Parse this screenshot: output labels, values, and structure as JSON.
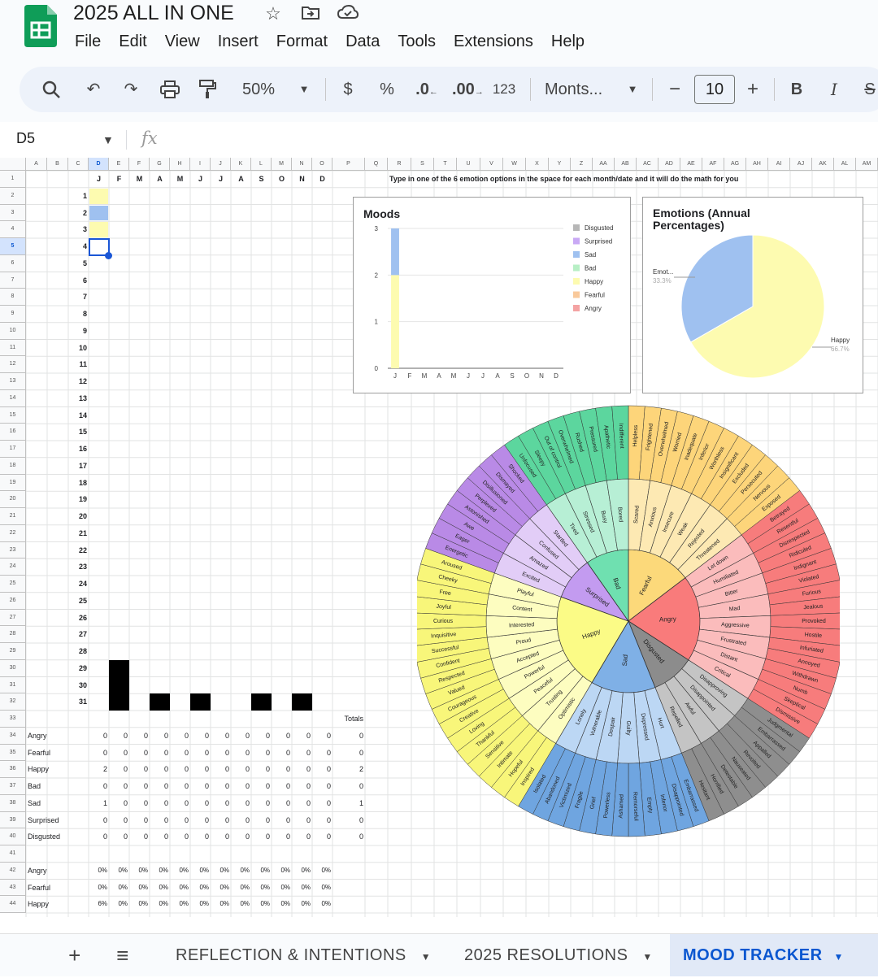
{
  "app": {
    "doc_title": "2025 ALL IN ONE",
    "menu": [
      "File",
      "Edit",
      "View",
      "Insert",
      "Format",
      "Data",
      "Tools",
      "Extensions",
      "Help"
    ],
    "icons": [
      "star-icon",
      "move-to-folder-icon",
      "cloud-status-icon"
    ]
  },
  "toolbar": {
    "zoom": "50%",
    "currency": "$",
    "percent": "%",
    "decrease_decimal": ".0",
    "increase_decimal": ".00",
    "number_format": "123",
    "font_name": "Monts...",
    "font_size": "10",
    "minus": "−",
    "plus": "+",
    "bold": "B",
    "italic": "I"
  },
  "formula_bar": {
    "cell_ref": "D5",
    "fx": "fx"
  },
  "sheet": {
    "columns": [
      "A",
      "B",
      "C",
      "D",
      "E",
      "F",
      "G",
      "H",
      "I",
      "J",
      "K",
      "L",
      "M",
      "N",
      "O",
      "P",
      "Q",
      "R",
      "S",
      "T",
      "U",
      "V",
      "W",
      "X",
      "Y",
      "Z",
      "AA",
      "AB",
      "AC",
      "AD",
      "AE",
      "AF",
      "AG",
      "AH",
      "AI",
      "AJ",
      "AK",
      "AL",
      "AM"
    ],
    "months": [
      "J",
      "F",
      "M",
      "A",
      "M",
      "J",
      "J",
      "A",
      "S",
      "O",
      "N",
      "D"
    ],
    "instruction": "Type in one of the 6 emotion options in the space for each month/date and it will do the math for you",
    "days": [
      "1",
      "2",
      "3",
      "4",
      "5",
      "6",
      "7",
      "8",
      "9",
      "10",
      "11",
      "12",
      "13",
      "14",
      "15",
      "16",
      "17",
      "18",
      "19",
      "20",
      "21",
      "22",
      "23",
      "24",
      "25",
      "26",
      "27",
      "28",
      "29",
      "30",
      "31"
    ],
    "totals_label": "Totals",
    "count_rows": [
      {
        "label": "Angry",
        "values": [
          "0",
          "0",
          "0",
          "0",
          "0",
          "0",
          "0",
          "0",
          "0",
          "0",
          "0",
          "0"
        ],
        "total": "0"
      },
      {
        "label": "Fearful",
        "values": [
          "0",
          "0",
          "0",
          "0",
          "0",
          "0",
          "0",
          "0",
          "0",
          "0",
          "0",
          "0"
        ],
        "total": "0"
      },
      {
        "label": "Happy",
        "values": [
          "2",
          "0",
          "0",
          "0",
          "0",
          "0",
          "0",
          "0",
          "0",
          "0",
          "0",
          "0"
        ],
        "total": "2"
      },
      {
        "label": "Bad",
        "values": [
          "0",
          "0",
          "0",
          "0",
          "0",
          "0",
          "0",
          "0",
          "0",
          "0",
          "0",
          "0"
        ],
        "total": "0"
      },
      {
        "label": "Sad",
        "values": [
          "1",
          "0",
          "0",
          "0",
          "0",
          "0",
          "0",
          "0",
          "0",
          "0",
          "0",
          "0"
        ],
        "total": "1"
      },
      {
        "label": "Surprised",
        "values": [
          "0",
          "0",
          "0",
          "0",
          "0",
          "0",
          "0",
          "0",
          "0",
          "0",
          "0",
          "0"
        ],
        "total": "0"
      },
      {
        "label": "Disgusted",
        "values": [
          "0",
          "0",
          "0",
          "0",
          "0",
          "0",
          "0",
          "0",
          "0",
          "0",
          "0",
          "0"
        ],
        "total": "0"
      }
    ],
    "pct_rows": [
      {
        "label": "Angry",
        "values": [
          "0%",
          "0%",
          "0%",
          "0%",
          "0%",
          "0%",
          "0%",
          "0%",
          "0%",
          "0%",
          "0%",
          "0%"
        ]
      },
      {
        "label": "Fearful",
        "values": [
          "0%",
          "0%",
          "0%",
          "0%",
          "0%",
          "0%",
          "0%",
          "0%",
          "0%",
          "0%",
          "0%",
          "0%"
        ]
      },
      {
        "label": "Happy",
        "values": [
          "6%",
          "0%",
          "0%",
          "0%",
          "0%",
          "0%",
          "0%",
          "0%",
          "0%",
          "0%",
          "0%",
          "0%"
        ]
      }
    ],
    "mood_entries": [
      {
        "day": 1,
        "color": "#fdfbb0"
      },
      {
        "day": 2,
        "color": "#9fc1f0"
      },
      {
        "day": 3,
        "color": "#fdfbb0"
      }
    ],
    "colors": {
      "happy": "#fdfbb0",
      "sad": "#9fc1f0",
      "selection": "#1a56d6",
      "black": "#000000"
    }
  },
  "chart_data": [
    {
      "type": "bar",
      "title": "Moods",
      "categories": [
        "J",
        "F",
        "M",
        "A",
        "M",
        "J",
        "J",
        "A",
        "S",
        "O",
        "N",
        "D"
      ],
      "stacked": true,
      "series": [
        {
          "name": "Disgusted",
          "color": "#b7b7b7",
          "values": [
            0,
            0,
            0,
            0,
            0,
            0,
            0,
            0,
            0,
            0,
            0,
            0
          ]
        },
        {
          "name": "Surprised",
          "color": "#c9a9f5",
          "values": [
            0,
            0,
            0,
            0,
            0,
            0,
            0,
            0,
            0,
            0,
            0,
            0
          ]
        },
        {
          "name": "Sad",
          "color": "#9fc1f0",
          "values": [
            1,
            0,
            0,
            0,
            0,
            0,
            0,
            0,
            0,
            0,
            0,
            0
          ]
        },
        {
          "name": "Bad",
          "color": "#b7efc5",
          "values": [
            0,
            0,
            0,
            0,
            0,
            0,
            0,
            0,
            0,
            0,
            0,
            0
          ]
        },
        {
          "name": "Happy",
          "color": "#fdfbb0",
          "values": [
            2,
            0,
            0,
            0,
            0,
            0,
            0,
            0,
            0,
            0,
            0,
            0
          ]
        },
        {
          "name": "Fearful",
          "color": "#f9c99b",
          "values": [
            0,
            0,
            0,
            0,
            0,
            0,
            0,
            0,
            0,
            0,
            0,
            0
          ]
        },
        {
          "name": "Angry",
          "color": "#f4a3a3",
          "values": [
            0,
            0,
            0,
            0,
            0,
            0,
            0,
            0,
            0,
            0,
            0,
            0
          ]
        }
      ],
      "ylim": [
        0,
        3
      ],
      "yticks": [
        "0",
        "1",
        "2",
        "3"
      ],
      "legend": "right"
    },
    {
      "type": "pie",
      "title": "Emotions (Annual Percentages)",
      "slices": [
        {
          "label": "Happy",
          "value": 66.7,
          "pct_label": "66.7%",
          "color": "#fdfbb0"
        },
        {
          "label": "Emot...",
          "value": 33.3,
          "pct_label": "33.3%",
          "color": "#9fc1f0"
        }
      ]
    }
  ],
  "wheel": {
    "core": [
      {
        "label": "Fearful",
        "color": "#fcd97a",
        "fill2": "#fde9b3",
        "fill3": "#fdd57a",
        "outer": [
          "Helpless",
          "Frightened",
          "Overwhelmed",
          "Worried",
          "Inadequate",
          "Inferior",
          "Worthless",
          "Insignificant",
          "Excluded",
          "Persecuted",
          "Nervous",
          "Exposed"
        ],
        "mid": [
          "Scared",
          "Anxious",
          "Insecure",
          "Weak",
          "Rejected",
          "Threatened"
        ]
      },
      {
        "label": "Angry",
        "color": "#f97b7b",
        "fill2": "#fbbcbc",
        "fill3": "#f77c7c",
        "outer": [
          "Betrayed",
          "Resentful",
          "Disrespected",
          "Ridiculed",
          "Indignant",
          "Violated",
          "Furious",
          "Jealous",
          "Provoked",
          "Hostile",
          "Infuriated",
          "Annoyed",
          "Withdrawn",
          "Numb",
          "Skeptical",
          "Dismissive"
        ],
        "mid": [
          "Let down",
          "Humiliated",
          "Bitter",
          "Mad",
          "Aggressive",
          "Frustrated",
          "Distant",
          "Critical"
        ]
      },
      {
        "label": "Disgusted",
        "color": "#8c8c8c",
        "fill2": "#c4c4c4",
        "fill3": "#8e8e8e",
        "outer": [
          "Judgmental",
          "Embarrassed",
          "Appalled",
          "Revolted",
          "Nauseated",
          "Detestable",
          "Horrified",
          "Hesitant"
        ],
        "mid": [
          "Disapproving",
          "Disappointed",
          "Awful",
          "Repelled"
        ]
      },
      {
        "label": "Sad",
        "color": "#7fb0e6",
        "fill2": "#bcd7f4",
        "fill3": "#6fa5e0",
        "outer": [
          "Embarrassed",
          "Disappointed",
          "Inferior",
          "Empty",
          "Remorseful",
          "Ashamed",
          "Powerless",
          "Grief",
          "Fragile",
          "Victimized",
          "Abandoned",
          "Isolated"
        ],
        "mid": [
          "Hurt",
          "Depressed",
          "Guilty",
          "Despair",
          "Vulnerable",
          "Lonely"
        ]
      },
      {
        "label": "Happy",
        "color": "#fbfb86",
        "fill2": "#fdfdc0",
        "fill3": "#f8f67a",
        "outer": [
          "Inspired",
          "Hopeful",
          "Intimate",
          "Sensitive",
          "Thankful",
          "Loving",
          "Creative",
          "Courageous",
          "Valued",
          "Respected",
          "Confident",
          "Successful",
          "Inquisitive",
          "Curious",
          "Joyful",
          "Free",
          "Cheeky",
          "Aroused"
        ],
        "mid": [
          "Optimistic",
          "Trusting",
          "Peaceful",
          "Powerful",
          "Accepted",
          "Proud",
          "Interested",
          "Content",
          "Playful"
        ]
      },
      {
        "label": "Surprised",
        "color": "#c39bf0",
        "fill2": "#e2cdf7",
        "fill3": "#b98ae6",
        "outer": [
          "Energetic",
          "Eager",
          "Awe",
          "Astonished",
          "Perplexed",
          "Disillusioned",
          "Dismayed",
          "Shocked"
        ],
        "mid": [
          "Excited",
          "Amazed",
          "Confused",
          "Startled"
        ]
      },
      {
        "label": "Bad",
        "color": "#6fe0b0",
        "fill2": "#b7efd5",
        "fill3": "#5cd69e",
        "outer": [
          "Unfocused",
          "Sleepy",
          "Out of control",
          "Overwhelmed",
          "Rushed",
          "Pressured",
          "Apathetic",
          "Indifferent"
        ],
        "mid": [
          "Tired",
          "Stressed",
          "Busy",
          "Bored"
        ]
      }
    ]
  },
  "tabs": {
    "add": "+",
    "list": "≡",
    "items": [
      {
        "label": "REFLECTION & INTENTIONS",
        "active": false
      },
      {
        "label": "2025 RESOLUTIONS",
        "active": false
      },
      {
        "label": "MOOD TRACKER",
        "active": true
      }
    ]
  }
}
